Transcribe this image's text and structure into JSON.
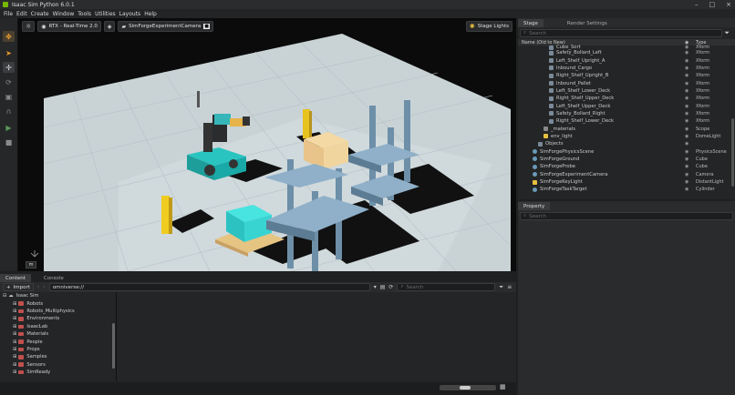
{
  "window": {
    "title": "Isaac Sim Python 6.0.1",
    "controls": [
      "–",
      "□",
      "×"
    ]
  },
  "menu": [
    "File",
    "Edit",
    "Create",
    "Window",
    "Tools",
    "Utilities",
    "Layouts",
    "Help"
  ],
  "viewport": {
    "renderer_label": "RTX - Real-Time 2.0",
    "camera_label": "SimForgeExperimentCamera",
    "lights_label": "Stage Lights",
    "units_badge": "m"
  },
  "stage": {
    "tabs": [
      "Stage",
      "Render Settings"
    ],
    "search_placeholder": "Search",
    "col_name": "Name (Old to New)",
    "col_type": "Type",
    "rows": [
      {
        "name": "Cube_Sort",
        "type": "Xform",
        "indent": 3,
        "icon": "xform",
        "partial": true
      },
      {
        "name": "Safety_Bollard_Left",
        "type": "Xform",
        "indent": 3,
        "icon": "xform"
      },
      {
        "name": "Left_Shelf_Upright_A",
        "type": "Xform",
        "indent": 3,
        "icon": "xform"
      },
      {
        "name": "Inbound_Cargo",
        "type": "Xform",
        "indent": 3,
        "icon": "xform"
      },
      {
        "name": "Right_Shelf_Upright_B",
        "type": "Xform",
        "indent": 3,
        "icon": "xform"
      },
      {
        "name": "Inbound_Pallet",
        "type": "Xform",
        "indent": 3,
        "icon": "xform"
      },
      {
        "name": "Left_Shelf_Lower_Deck",
        "type": "Xform",
        "indent": 3,
        "icon": "xform"
      },
      {
        "name": "Right_Shelf_Upper_Deck",
        "type": "Xform",
        "indent": 3,
        "icon": "xform"
      },
      {
        "name": "Left_Shelf_Upper_Deck",
        "type": "Xform",
        "indent": 3,
        "icon": "xform"
      },
      {
        "name": "Safety_Bollard_Right",
        "type": "Xform",
        "indent": 3,
        "icon": "xform"
      },
      {
        "name": "Right_Shelf_Lower_Deck",
        "type": "Xform",
        "indent": 3,
        "icon": "xform"
      },
      {
        "name": "_materials",
        "type": "Scope",
        "indent": 2,
        "icon": "folder"
      },
      {
        "name": "env_light",
        "type": "DomeLight",
        "indent": 2,
        "icon": "light"
      },
      {
        "name": "Objects",
        "type": "",
        "indent": 1,
        "icon": "xform"
      },
      {
        "name": "SimForgePhysicsScene",
        "type": "PhysicsScene",
        "indent": 0,
        "icon": "prim"
      },
      {
        "name": "SimForgeGround",
        "type": "Cube",
        "indent": 0,
        "icon": "prim"
      },
      {
        "name": "SimForgeProbe",
        "type": "Cube",
        "indent": 0,
        "icon": "prim"
      },
      {
        "name": "SimForgeExperimentCamera",
        "type": "Camera",
        "indent": 0,
        "icon": "prim"
      },
      {
        "name": "SimForgeKeyLight",
        "type": "DistantLight",
        "indent": 0,
        "icon": "light"
      },
      {
        "name": "SimForgeTaskTarget",
        "type": "Cylinder",
        "indent": 0,
        "icon": "prim"
      }
    ]
  },
  "property": {
    "tab": "Property",
    "search_placeholder": "Search"
  },
  "content": {
    "tabs": [
      "Content",
      "Console"
    ],
    "import_label": "Import",
    "path": "omniverse://",
    "search_placeholder": "Search",
    "root": "Isaac Sim",
    "folders": [
      "Robots",
      "Robots_Multiphysics",
      "Environments",
      "IsaacLab",
      "Materials",
      "People",
      "Props",
      "Samples",
      "Sensors",
      "SimReady"
    ]
  }
}
